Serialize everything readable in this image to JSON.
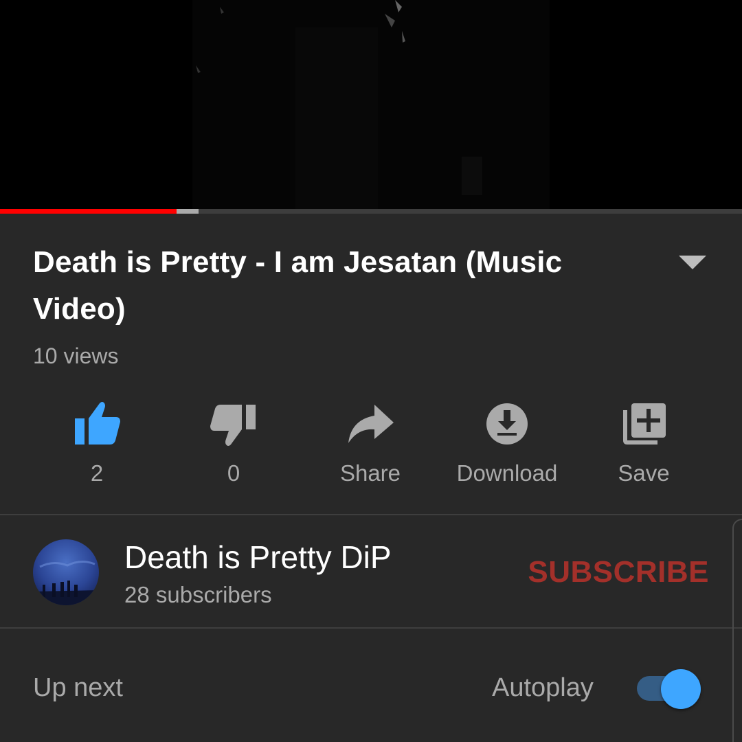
{
  "player": {
    "progress_played": 0.238,
    "progress_buffered": 0.268,
    "colors": {
      "played": "#ff0000",
      "buffered": "#aaaaaa"
    }
  },
  "video": {
    "title": "Death is Pretty - I am Jesatan (Music Video)",
    "views": "10 views"
  },
  "actions": [
    {
      "id": "like",
      "label": "2",
      "icon": "thumbs-up-icon",
      "color": "#3ea6ff"
    },
    {
      "id": "dislike",
      "label": "0",
      "icon": "thumbs-down-icon",
      "color": "#aaaaaa"
    },
    {
      "id": "share",
      "label": "Share",
      "icon": "share-icon",
      "color": "#aaaaaa"
    },
    {
      "id": "download",
      "label": "Download",
      "icon": "download-icon",
      "color": "#aaaaaa"
    },
    {
      "id": "save",
      "label": "Save",
      "icon": "add-to-playlist-icon",
      "color": "#aaaaaa"
    }
  ],
  "channel": {
    "name": "Death is Pretty DiP",
    "subscribers": "28 subscribers",
    "subscribe_label": "SUBSCRIBE",
    "subscribe_color": "#a3302a"
  },
  "up_next": {
    "label": "Up next",
    "autoplay_label": "Autoplay",
    "autoplay_on": true,
    "toggle_color": "#3ea6ff"
  }
}
